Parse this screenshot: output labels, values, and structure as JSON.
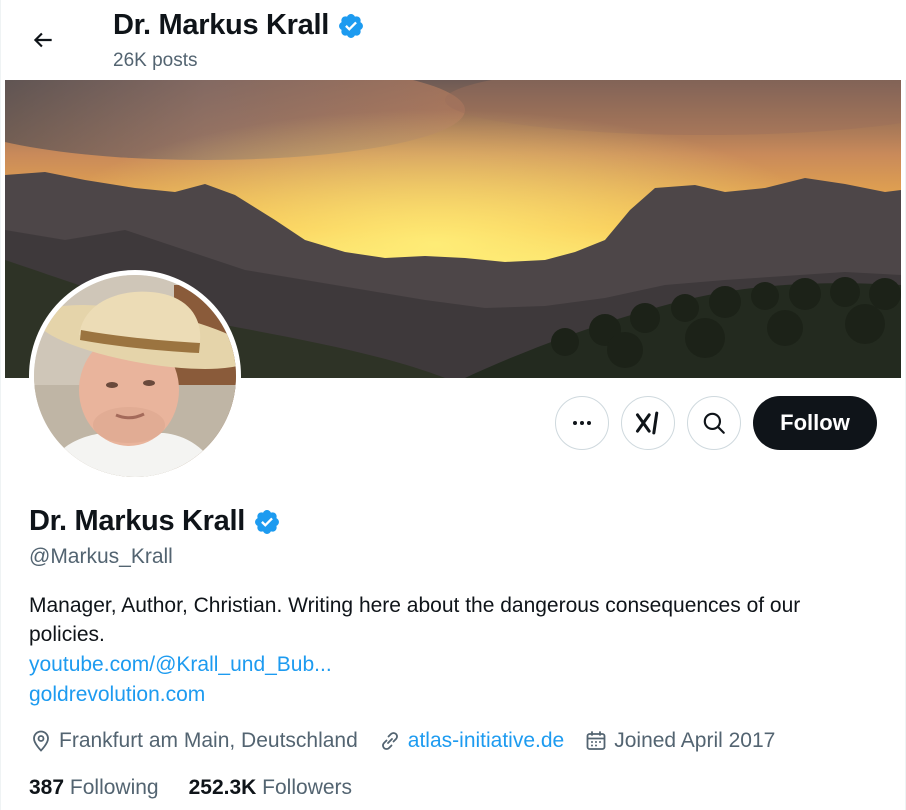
{
  "header": {
    "display_name": "Dr. Markus Krall",
    "posts_count": "26K posts"
  },
  "actions": {
    "follow_label": "Follow"
  },
  "profile": {
    "display_name": "Dr. Markus Krall",
    "handle": "@Markus_Krall",
    "bio": "Manager, Author, Christian. Writing here about the dangerous consequences of our policies.",
    "links": [
      "youtube.com/@Krall_und_Bub...",
      "goldrevolution.com"
    ],
    "location": "Frankfurt am Main, Deutschland",
    "website": "atlas-initiative.de",
    "joined": "Joined April 2017",
    "following_count": "387",
    "following_label": "Following",
    "followers_count": "252.3K",
    "followers_label": "Followers",
    "verified": true
  },
  "colors": {
    "accent": "#1d9bf0",
    "text": "#0f1419",
    "secondary_text": "#536471",
    "follow_button_bg": "#0f1419"
  },
  "icons": [
    "back-arrow-icon",
    "verified-badge-icon",
    "more-icon",
    "grok-icon",
    "search-icon",
    "location-icon",
    "link-icon",
    "calendar-icon"
  ]
}
